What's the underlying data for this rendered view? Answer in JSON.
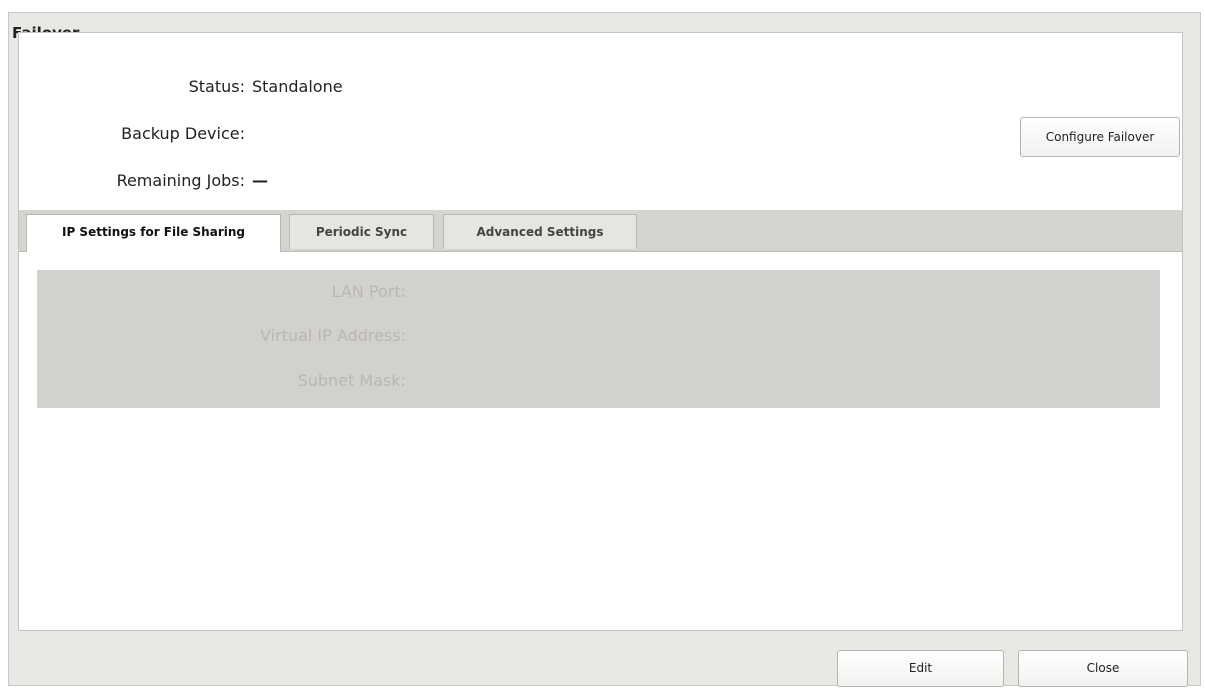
{
  "dialog": {
    "title": "Failover"
  },
  "info": {
    "status_label": "Status:",
    "status_value": "Standalone",
    "backup_device_label": "Backup Device:",
    "backup_device_value": "",
    "remaining_jobs_label": "Remaining Jobs:",
    "remaining_jobs_value": "—"
  },
  "buttons": {
    "configure_failover": "Configure Failover",
    "edit": "Edit",
    "close": "Close"
  },
  "tabs": [
    {
      "label": "IP Settings for File Sharing",
      "active": true
    },
    {
      "label": "Periodic Sync",
      "active": false
    },
    {
      "label": "Advanced Settings",
      "active": false
    }
  ],
  "ip_settings": {
    "lan_port_label": "LAN Port:",
    "virtual_ip_label": "Virtual IP Address:",
    "subnet_mask_label": "Subnet Mask:",
    "disabled": true
  },
  "colors": {
    "dialog_bg": "#e9e8e5",
    "tab_bar_bg": "#d6d4d0",
    "disabled_panel_bg": "#d3d1cd",
    "disabled_text": "#b9b7b3"
  }
}
